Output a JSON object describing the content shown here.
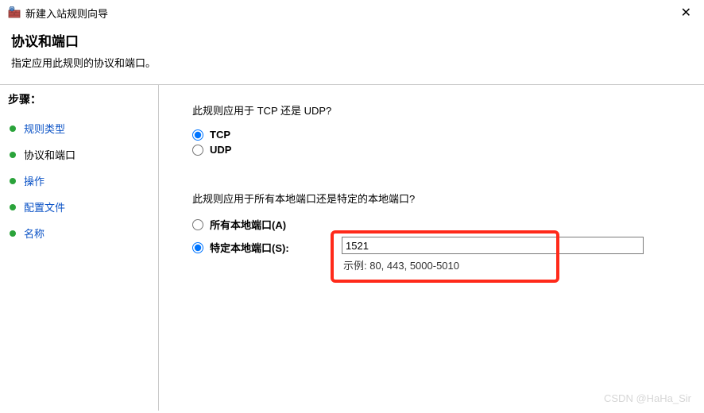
{
  "titlebar": {
    "title": "新建入站规则向导",
    "close_glyph": "✕"
  },
  "header": {
    "title": "协议和端口",
    "subtitle": "指定应用此规则的协议和端口。"
  },
  "sidebar": {
    "steps_label": "步骤：",
    "items": [
      {
        "label": "规则类型",
        "current": false
      },
      {
        "label": "协议和端口",
        "current": true
      },
      {
        "label": "操作",
        "current": false
      },
      {
        "label": "配置文件",
        "current": false
      },
      {
        "label": "名称",
        "current": false
      }
    ]
  },
  "content": {
    "q1": "此规则应用于 TCP 还是 UDP?",
    "tcp_label": "TCP",
    "udp_label": "UDP",
    "q2": "此规则应用于所有本地端口还是特定的本地端口?",
    "all_ports_label": "所有本地端口(A)",
    "specific_ports_label": "特定本地端口(S):",
    "port_value": "1521",
    "example_text": "示例: 80, 443, 5000-5010"
  },
  "watermark": "CSDN @HaHa_Sir"
}
